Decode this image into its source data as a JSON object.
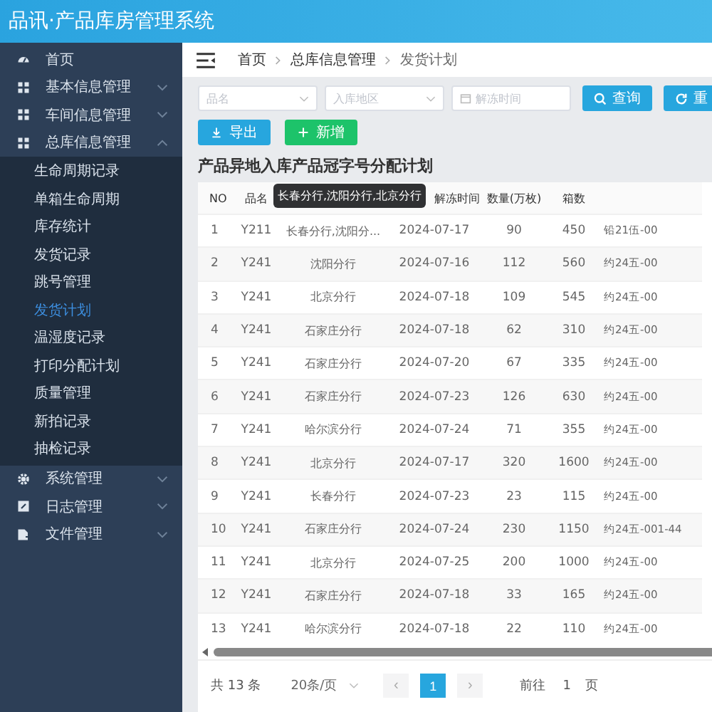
{
  "header": {
    "title": "品讯·产品库房管理系统"
  },
  "sidebar": {
    "items": [
      {
        "label": "首页",
        "kind": "dashboard"
      },
      {
        "label": "基本信息管理",
        "kind": "grid",
        "expanded": false
      },
      {
        "label": "车间信息管理",
        "kind": "grid",
        "expanded": false
      },
      {
        "label": "总库信息管理",
        "kind": "grid",
        "expanded": true,
        "children": [
          {
            "label": "生命周期记录",
            "selected": false
          },
          {
            "label": "单箱生命周期",
            "selected": false
          },
          {
            "label": "库存统计",
            "selected": false
          },
          {
            "label": "发货记录",
            "selected": false
          },
          {
            "label": "跳号管理",
            "selected": false
          },
          {
            "label": "发货计划",
            "selected": true
          },
          {
            "label": "温湿度记录",
            "selected": false
          },
          {
            "label": "打印分配计划",
            "selected": false
          },
          {
            "label": "质量管理",
            "selected": false
          },
          {
            "label": "新拍记录",
            "selected": false
          },
          {
            "label": "抽检记录",
            "selected": false
          }
        ]
      },
      {
        "label": "系统管理",
        "kind": "gear",
        "expanded": false
      },
      {
        "label": "日志管理",
        "kind": "edit",
        "expanded": false
      },
      {
        "label": "文件管理",
        "kind": "file",
        "expanded": false
      }
    ]
  },
  "breadcrumb": [
    "首页",
    "总库信息管理",
    "发货计划"
  ],
  "filters": [
    {
      "kind": "select",
      "placeholder": "品名"
    },
    {
      "kind": "select",
      "placeholder": "入库地区"
    },
    {
      "kind": "date",
      "placeholder": "解冻时间"
    }
  ],
  "filter_buttons": [
    {
      "label": "查询",
      "kind": "search"
    },
    {
      "label": "重",
      "kind": "refresh"
    }
  ],
  "actions": [
    {
      "label": "导出",
      "kind": "export"
    },
    {
      "label": "新增",
      "kind": "add"
    }
  ],
  "table": {
    "title": "产品异地入库产品冠字号分配计划",
    "tooltip": "长春分行,沈阳分行,北京分行",
    "columns": [
      "NO",
      "品名",
      null,
      "解冻时间",
      "数量(万枚)",
      "箱数",
      null
    ],
    "rows": [
      [
        "1",
        "Y211",
        "长春分行,沈阳分...",
        "2024-07-17",
        "90",
        "450",
        "铅21伍-00"
      ],
      [
        "2",
        "Y241",
        "沈阳分行",
        "2024-07-16",
        "112",
        "560",
        "约24五-00"
      ],
      [
        "3",
        "Y241",
        "北京分行",
        "2024-07-18",
        "109",
        "545",
        "约24五-00"
      ],
      [
        "4",
        "Y241",
        "石家庄分行",
        "2024-07-18",
        "62",
        "310",
        "约24五-00"
      ],
      [
        "5",
        "Y241",
        "石家庄分行",
        "2024-07-20",
        "67",
        "335",
        "约24五-00"
      ],
      [
        "6",
        "Y241",
        "石家庄分行",
        "2024-07-23",
        "126",
        "630",
        "约24五-00"
      ],
      [
        "7",
        "Y241",
        "哈尔滨分行",
        "2024-07-24",
        "71",
        "355",
        "约24五-00"
      ],
      [
        "8",
        "Y241",
        "北京分行",
        "2024-07-17",
        "320",
        "1600",
        "约24五-00"
      ],
      [
        "9",
        "Y241",
        "长春分行",
        "2024-07-23",
        "23",
        "115",
        "约24五-00"
      ],
      [
        "10",
        "Y241",
        "石家庄分行",
        "2024-07-24",
        "230",
        "1150",
        "约24五-001-44"
      ],
      [
        "11",
        "Y241",
        "北京分行",
        "2024-07-25",
        "200",
        "1000",
        "约24五-00"
      ],
      [
        "12",
        "Y241",
        "石家庄分行",
        "2024-07-18",
        "33",
        "165",
        "约24五-00"
      ],
      [
        "13",
        "Y241",
        "哈尔滨分行",
        "2024-07-18",
        "22",
        "110",
        "约24五-00"
      ]
    ]
  },
  "pagination": {
    "total": "共 13 条",
    "page_size": "20条/页",
    "prev": "‹",
    "pages": [
      {
        "label": "1",
        "selected": true
      }
    ],
    "next": "›",
    "goto": "前往",
    "goto_value": "1",
    "page_unit": "页"
  }
}
